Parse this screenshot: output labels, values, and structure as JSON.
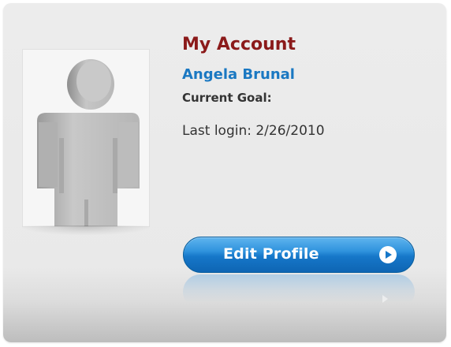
{
  "account": {
    "title": "My Account",
    "user_name": "Angela Brunal",
    "goal_label": "Current Goal:",
    "last_login": "Last login: 2/26/2010"
  },
  "actions": {
    "edit_profile_label": "Edit Profile"
  },
  "colors": {
    "title": "#8b1a1a",
    "user_name": "#1a78c2",
    "button": "#1677c9"
  },
  "icons": {
    "avatar": "user-silhouette-icon",
    "button_arrow": "play-arrow-icon"
  }
}
